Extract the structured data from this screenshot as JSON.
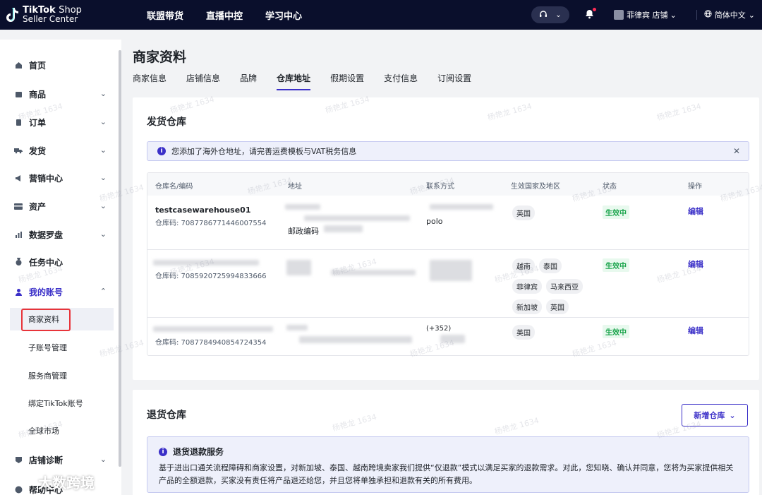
{
  "topbar": {
    "logo_line1": "TikTok",
    "logo_line1_b": "Shop",
    "logo_line2": "Seller Center",
    "nav": [
      "联盟带货",
      "直播中控",
      "学习中心"
    ],
    "store_name": "菲律宾 店铺",
    "language": "简体中文"
  },
  "sidebar": {
    "items": [
      {
        "label": "首页",
        "icon": "home-icon",
        "chev": ""
      },
      {
        "label": "商品",
        "icon": "product-icon",
        "chev": "⌄"
      },
      {
        "label": "订单",
        "icon": "order-icon",
        "chev": "⌄"
      },
      {
        "label": "发货",
        "icon": "truck-icon",
        "chev": "⌄"
      },
      {
        "label": "营销中心",
        "icon": "megaphone-icon",
        "chev": "⌄"
      },
      {
        "label": "资产",
        "icon": "card-icon",
        "chev": "⌄"
      },
      {
        "label": "数据罗盘",
        "icon": "chart-icon",
        "chev": "⌄"
      },
      {
        "label": "任务中心",
        "icon": "medal-icon",
        "chev": ""
      },
      {
        "label": "我的账号",
        "icon": "user-icon",
        "chev": "⌃"
      }
    ],
    "sub_items": [
      "商家资料",
      "子账号管理",
      "服务商管理",
      "绑定TikTok账号",
      "全球市场"
    ],
    "bottom_items": [
      {
        "label": "店铺诊断",
        "chev": "⌄"
      },
      {
        "label": "帮助中心",
        "chev": ""
      }
    ]
  },
  "page": {
    "title": "商家资料",
    "tabs": [
      "商家信息",
      "店铺信息",
      "品牌",
      "仓库地址",
      "假期设置",
      "支付信息",
      "订阅设置"
    ]
  },
  "shipping": {
    "title": "发货仓库",
    "notice": "您添加了海外仓地址，请完善运费模板与VAT税务信息",
    "columns": [
      "仓库名/编码",
      "地址",
      "联系方式",
      "生效国家及地区",
      "状态",
      "操作"
    ],
    "rows": [
      {
        "name": "testcasewarehouse01",
        "code": "仓库码: 7087786771446007554",
        "address_text": "邮政编码",
        "contact_text": "polo",
        "regions": [
          "英国"
        ],
        "status": "生效中",
        "action": "编辑"
      },
      {
        "name": "",
        "code": "仓库码: 7085920725994833666",
        "address_text": "",
        "contact_text": "",
        "regions": [
          "越南",
          "泰国",
          "菲律宾",
          "马来西亚",
          "新加坡",
          "英国"
        ],
        "status": "生效中",
        "action": "编辑"
      },
      {
        "name": "",
        "code": "仓库码: 7087784940854724354",
        "address_text": "",
        "contact_text": "(+352)",
        "regions": [
          "英国"
        ],
        "status": "生效中",
        "action": "编辑"
      }
    ]
  },
  "returns": {
    "title": "退货仓库",
    "add_button": "新增仓库",
    "refund_title": "退货退款服务",
    "refund_text": "基于进出口通关流程障碍和商家设置，对新加坡、泰国、越南跨境卖家我们提供“仅退款”模式以满足买家的退款需求。对此，您知晓、确认并同意，您将为买家提供相关产品的全额退款，买家没有责任将产品退还给您，并且您将单独承担和退款有关的所有费用。"
  },
  "watermark": "杨艳龙 1634",
  "brand_overlay": "大数跨境",
  "colors": {
    "accent": "#3b30c8",
    "topbar": "#0a0f2c",
    "success": "#18a34a",
    "highlight": "#e8343a"
  }
}
